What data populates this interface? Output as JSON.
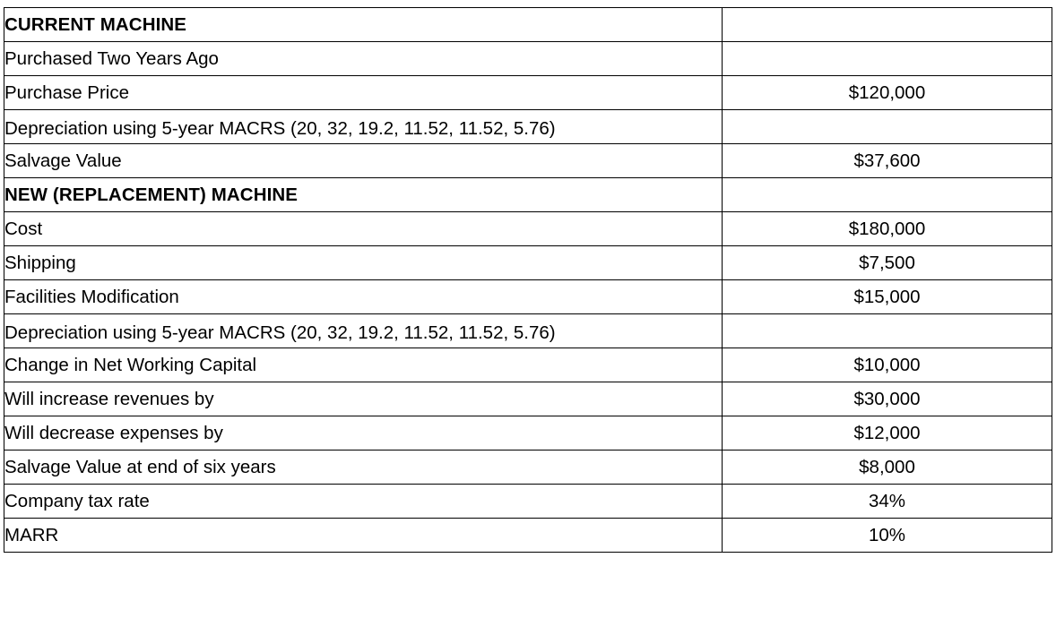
{
  "document": {
    "type": "capital-budgeting-assumptions-table",
    "columns": 2,
    "row_count": 16
  },
  "table": {
    "rows": [
      {
        "label": "CURRENT MACHINE",
        "value": "",
        "is_header": true,
        "tall": false
      },
      {
        "label": "Purchased Two Years Ago",
        "value": "",
        "is_header": false,
        "tall": false
      },
      {
        "label": "Purchase Price",
        "value": "$120,000",
        "is_header": false,
        "tall": false
      },
      {
        "label": "Depreciation using 5-year MACRS (20, 32, 19.2, 11.52, 11.52, 5.76)",
        "value": "",
        "is_header": false,
        "tall": true
      },
      {
        "label": "Salvage Value",
        "value": "$37,600",
        "is_header": false,
        "tall": false
      },
      {
        "label": "NEW (REPLACEMENT) MACHINE",
        "value": "",
        "is_header": true,
        "tall": false
      },
      {
        "label": "Cost",
        "value": "$180,000",
        "is_header": false,
        "tall": false
      },
      {
        "label": "Shipping",
        "value": "$7,500",
        "is_header": false,
        "tall": false
      },
      {
        "label": "Facilities Modification",
        "value": "$15,000",
        "is_header": false,
        "tall": false
      },
      {
        "label": "Depreciation using 5-year MACRS (20, 32, 19.2, 11.52, 11.52, 5.76)",
        "value": "",
        "is_header": false,
        "tall": true
      },
      {
        "label": "Change in Net Working Capital",
        "value": "$10,000",
        "is_header": false,
        "tall": false
      },
      {
        "label": "Will increase revenues by",
        "value": "$30,000",
        "is_header": false,
        "tall": false
      },
      {
        "label": "Will decrease expenses by",
        "value": "$12,000",
        "is_header": false,
        "tall": false
      },
      {
        "label": "Salvage Value at end of six years",
        "value": "$8,000",
        "is_header": false,
        "tall": false
      },
      {
        "label": "Company tax rate",
        "value": "34%",
        "is_header": false,
        "tall": false
      },
      {
        "label": "MARR",
        "value": "10%",
        "is_header": false,
        "tall": false
      }
    ]
  },
  "colors": {
    "text": "#000000",
    "border": "#000000",
    "background": "#ffffff"
  }
}
